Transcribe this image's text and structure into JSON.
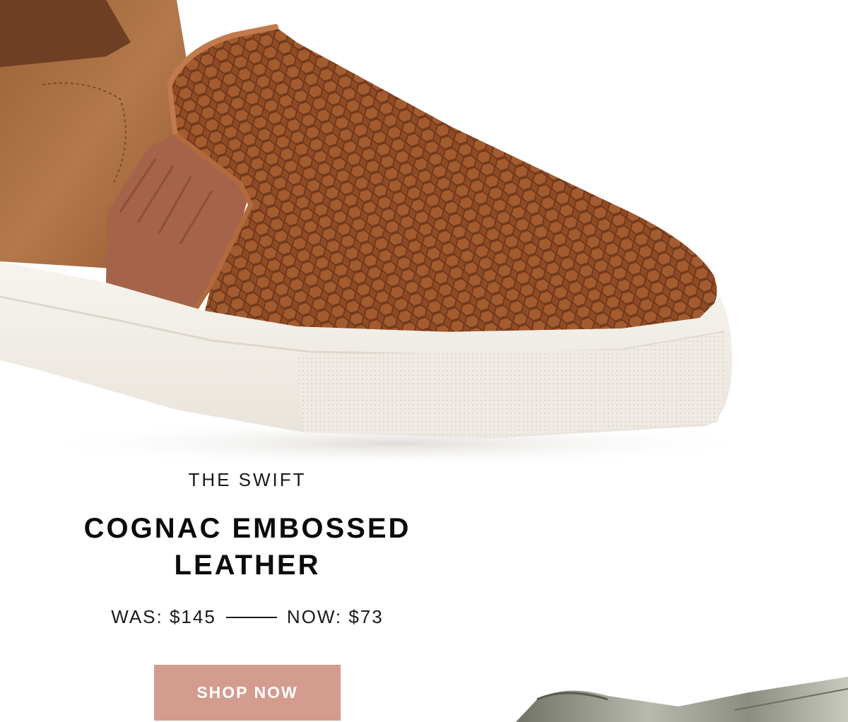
{
  "product": {
    "eyebrow": "THE SWIFT",
    "title_line1": "COGNAC EMBOSSED",
    "title_line2": "LEATHER",
    "was_label": "WAS: $145",
    "now_label": "NOW: $73",
    "cta_label": "SHOP NOW"
  },
  "colors": {
    "leather": "#8f4b25",
    "suede": "#a86f45",
    "sole": "#f1ede6",
    "cta_background": "#d39c8e",
    "cta_text": "#ffffff",
    "text": "#0b0b0b"
  },
  "imagery": {
    "hero": "cognac-embossed-leather-slip-on-sneaker",
    "secondary": "metallic-slip-on-sneaker-partial"
  }
}
